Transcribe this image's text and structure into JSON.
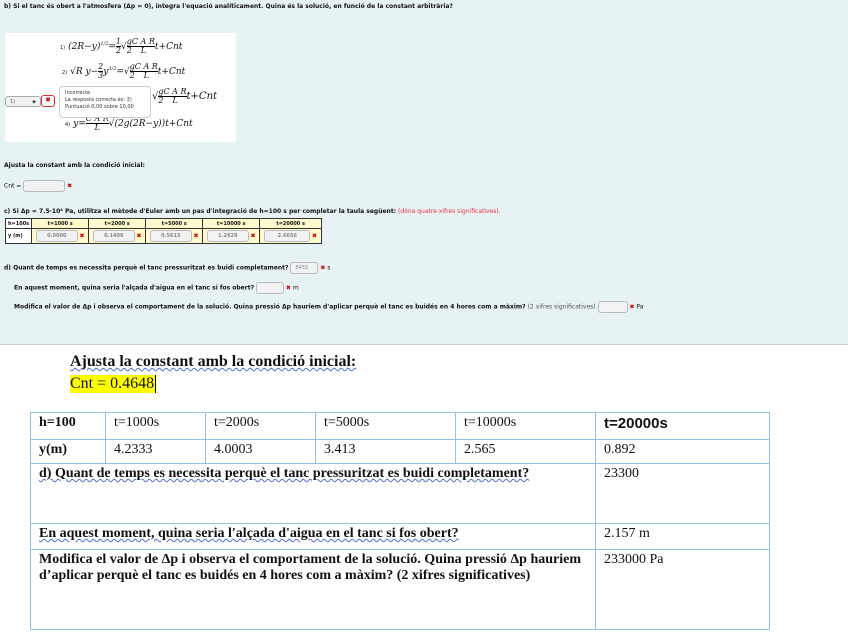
{
  "top": {
    "question_b": "b) Si el tanc és obert a l'atmosfera (Δp = 0), integra l'equació analíticament. Quina és la solució, en funció de la constant arbitrària?",
    "options": [
      "1)",
      "2)",
      "3)",
      "4)"
    ],
    "select_value": "1)",
    "feedback": {
      "status": "Incorrecte",
      "correct": "La resposta correcta és: 3)",
      "score": "Puntuació 0,00 sobre 10,00"
    },
    "adjust_label": "Ajusta la constant amb la condició inicial:",
    "cnt_label": "Cnt =",
    "question_c": "c) Si Δp = 7.5·10⁴ Pa, utilitza el mètode d'Euler amb un pas d'integració de h=100 s per completar la taula següent:",
    "question_c_note": "(dóna quatre xifres significatives).",
    "euler_headers": [
      "h=100s",
      "t=1000 s",
      "t=2000 s",
      "t=5000 s",
      "t=10000 s",
      "t=20000 s"
    ],
    "euler_row_label": "y (m)",
    "euler_values": [
      "0.0000",
      "0.1406",
      "0.5615",
      "1.2629",
      "2.6656"
    ],
    "question_d": "d) Quant de temps es necessita perquè el tanc pressuritzat es buidi completament?",
    "d_value": "8455",
    "d_unit": "s",
    "question_d2": "En aquest moment, quina seria l'alçada d'aigua en el tanc si fos obert?",
    "d2_unit": "m",
    "question_d3": "Modifica el valor de Δp i observa el comportament de la solució. Quina pressió  Δp hauriem d'aplicar perquè el tanc es buidés en 4 hores com a màxim?",
    "d3_note": "(2 xifres significatives)",
    "d3_unit": "Pa",
    "wrong_mark": "✖"
  },
  "doc": {
    "adjust": "Ajusta la constant amb la condició inicial:",
    "cnt": "Cnt = 0.4648",
    "headers": [
      "h=100",
      "t=1000s",
      "t=2000s",
      "t=5000s",
      "t=10000s",
      "t=20000s"
    ],
    "row_label": "y(m)",
    "values": [
      "4.2333",
      "4.0003",
      "3.413",
      "2.565",
      "0.892"
    ],
    "q1": "d) Quant de temps es necessita perquè el tanc pressuritzat es buidi completament?",
    "a1": "23300",
    "q2": "En aquest moment, quina seria l'alçada d'aigua en el tanc si fos obert?",
    "a2": "2.157 m",
    "q3": "Modifica el valor de Δp i observa el comportament de la solució. Quina pressió  Δp hauriem d’aplicar perquè el tanc es buidés en 4 hores com a màxim? (2 xifres significatives)",
    "a3": "233000 Pa"
  }
}
